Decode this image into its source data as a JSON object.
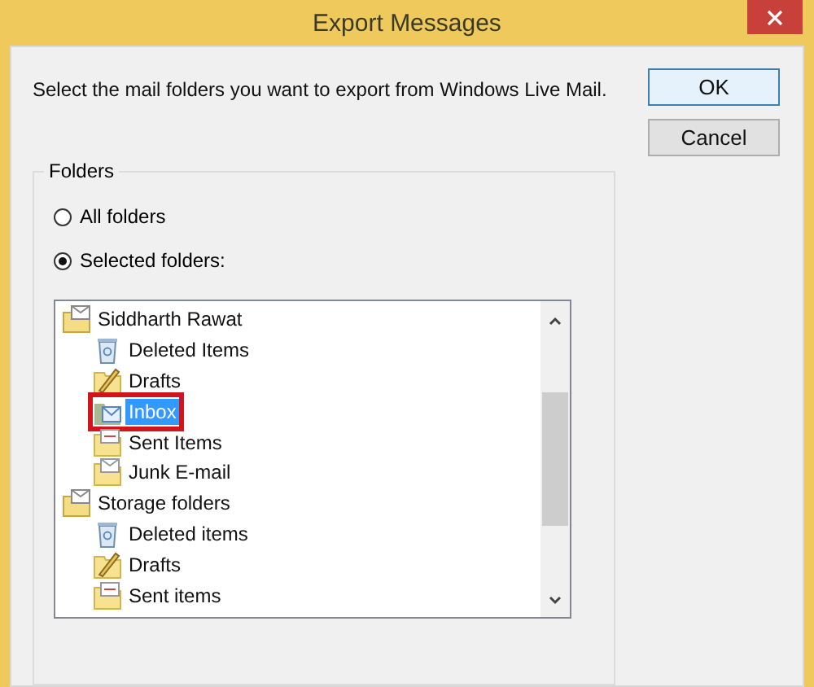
{
  "window": {
    "title": "Export Messages"
  },
  "instruction": "Select the mail folders you want to export from Windows Live Mail.",
  "buttons": [
    {
      "label": "OK",
      "default": true
    },
    {
      "label": "Cancel",
      "default": false
    }
  ],
  "group": {
    "title": "Folders",
    "options": [
      {
        "label": "All folders",
        "selected": false
      },
      {
        "label": "Selected folders:",
        "selected": true
      }
    ],
    "tree": [
      {
        "label": "Siddharth Rawat",
        "kind": "account",
        "selected": false,
        "annotated": false,
        "children": [
          {
            "label": "Deleted Items",
            "kind": "deleted",
            "selected": false,
            "annotated": false
          },
          {
            "label": "Drafts",
            "kind": "drafts",
            "selected": false,
            "annotated": false
          },
          {
            "label": "Inbox",
            "kind": "inbox",
            "selected": true,
            "annotated": true
          },
          {
            "label": "Sent Items",
            "kind": "sent",
            "selected": false,
            "annotated": false
          },
          {
            "label": "Junk E-mail",
            "kind": "junk",
            "selected": false,
            "annotated": false
          }
        ]
      },
      {
        "label": "Storage folders",
        "kind": "account",
        "selected": false,
        "annotated": false,
        "children": [
          {
            "label": "Deleted items",
            "kind": "deleted",
            "selected": false,
            "annotated": false
          },
          {
            "label": "Drafts",
            "kind": "drafts",
            "selected": false,
            "annotated": false
          },
          {
            "label": "Sent items",
            "kind": "sent",
            "selected": false,
            "annotated": false
          }
        ]
      }
    ]
  }
}
